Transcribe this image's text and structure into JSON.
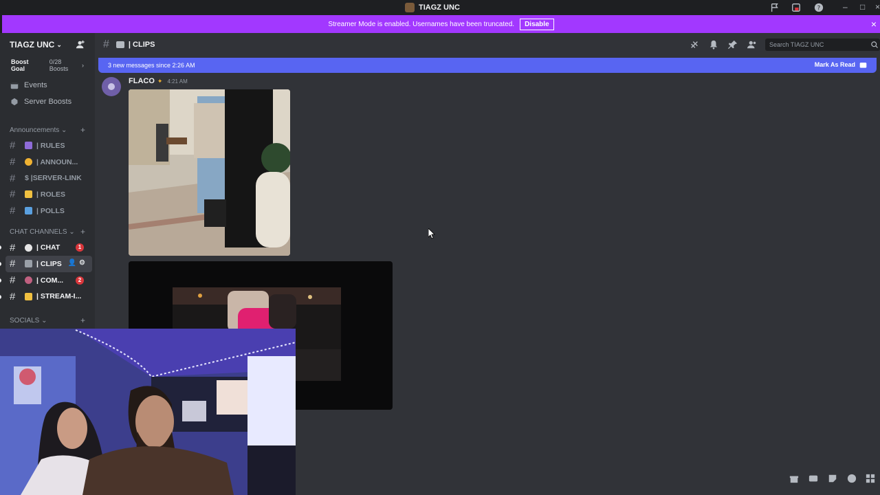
{
  "window": {
    "title": "TIAGZ UNC"
  },
  "banner": {
    "text": "Streamer Mode is enabled. Usernames have been truncated.",
    "button": "Disable"
  },
  "server": {
    "name": "TIAGZ UNC",
    "boost_goal": "Boost Goal",
    "boost_count": "0/28 Boosts",
    "links": [
      {
        "label": "Events",
        "icon": "calendar-icon"
      },
      {
        "label": "Server Boosts",
        "icon": "boost-icon"
      }
    ],
    "categories": {
      "announcements": "Announcements",
      "chat": "CHAT CHANNELS",
      "socials": "SOCIALS"
    },
    "announcement_channels": [
      {
        "label": "| RULES",
        "emoji_color": "#8e6bd8"
      },
      {
        "label": "| ANNOUN...",
        "emoji_color": "#f0b232"
      },
      {
        "label": "$ |SERVER-LINK",
        "emoji_color": ""
      },
      {
        "label": "| ROLES",
        "emoji_color": "#f0c040"
      },
      {
        "label": "| POLLS",
        "emoji_color": "#5aa0e0"
      }
    ],
    "chat_channels": [
      {
        "label": "| CHAT",
        "badge": "1"
      },
      {
        "label": "| CLIPS",
        "badge": ""
      },
      {
        "label": "| COM...",
        "badge": "2"
      },
      {
        "label": "| STREAM-I...",
        "badge": ""
      }
    ]
  },
  "header": {
    "channel": "| CLIPS",
    "search_placeholder": "Search TIAGZ UNC"
  },
  "chat": {
    "new_messages": "3 new messages since 2:26 AM",
    "mark_as_read": "Mark As Read",
    "message": {
      "author": "FLACO",
      "time": "4:21 AM"
    }
  },
  "colors": {
    "accent": "#5865f2",
    "streamer_banner": "#a238ff",
    "unread_badge": "#da373c"
  }
}
